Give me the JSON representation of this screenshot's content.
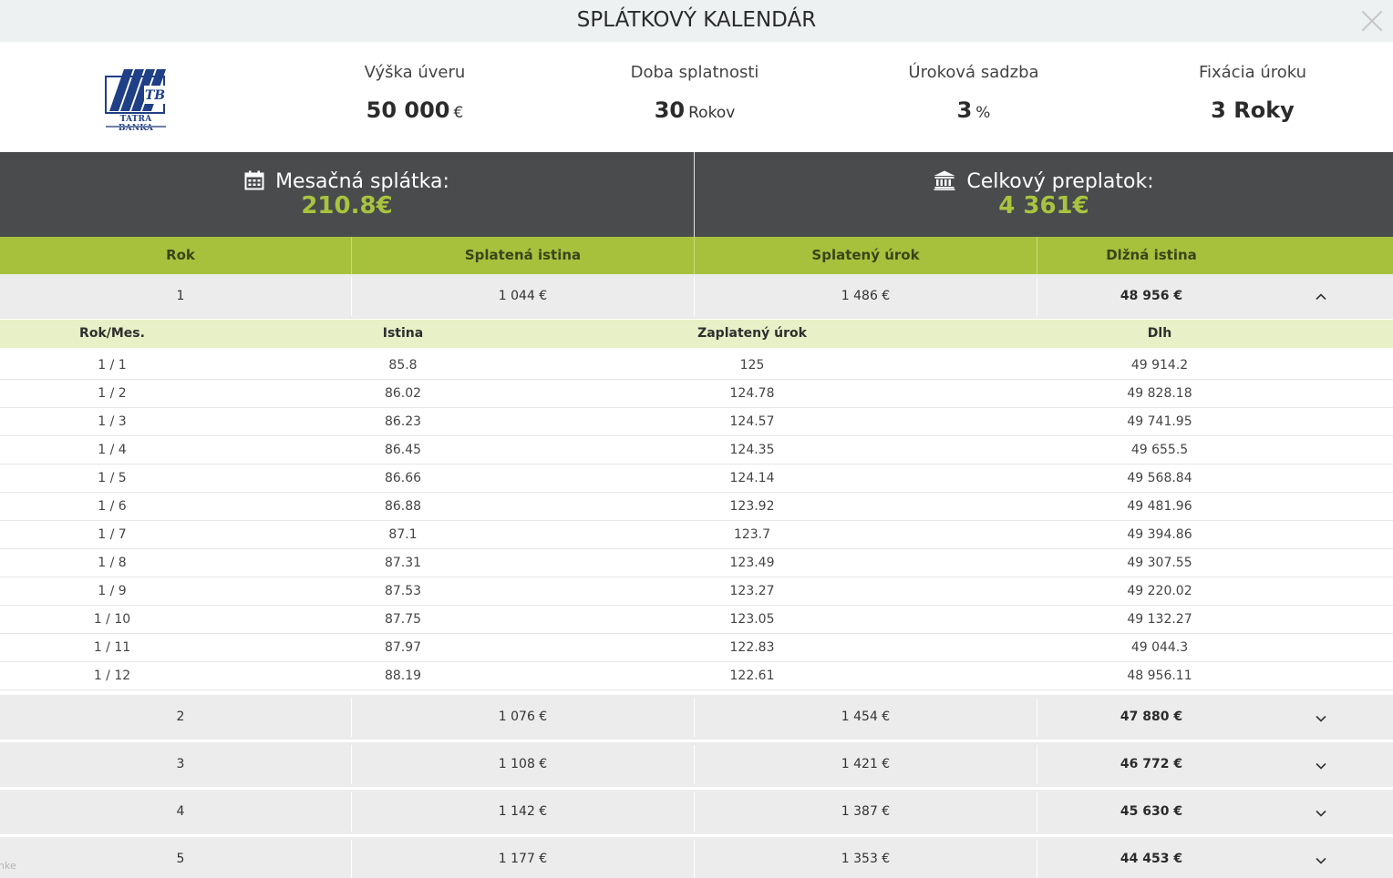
{
  "window": {
    "title": "SPLÁTKOVÝ KALENDÁR"
  },
  "bank": {
    "logo_mark": "TB",
    "logo_name": "TATRA BANKA"
  },
  "summary": {
    "loan_amount": {
      "label": "Výška úveru",
      "value": "50 000",
      "unit": "€"
    },
    "term": {
      "label": "Doba splatnosti",
      "value": "30",
      "unit": "Rokov"
    },
    "interest_rate": {
      "label": "Úroková sadzba",
      "value": "3",
      "unit": "%"
    },
    "fixation": {
      "label": "Fixácia úroku",
      "value": "3 Roky",
      "unit": ""
    }
  },
  "highlights": {
    "monthly_payment": {
      "label": "Mesačná splátka:",
      "value": "210.8€",
      "icon": "calendar-icon"
    },
    "total_overpayment": {
      "label": "Celkový preplatok:",
      "value": "4 361€",
      "icon": "bank-icon"
    }
  },
  "table": {
    "headers": [
      "Rok",
      "Splatená istina",
      "Splatený úrok",
      "Dlžná istina"
    ],
    "years": [
      {
        "year": "1",
        "principal": "1 044 €",
        "interest": "1 486 €",
        "remaining": "48 956 €",
        "expanded": true
      },
      {
        "year": "2",
        "principal": "1 076 €",
        "interest": "1 454 €",
        "remaining": "47 880 €",
        "expanded": false
      },
      {
        "year": "3",
        "principal": "1 108 €",
        "interest": "1 421 €",
        "remaining": "46 772 €",
        "expanded": false
      },
      {
        "year": "4",
        "principal": "1 142 €",
        "interest": "1 387 €",
        "remaining": "45 630 €",
        "expanded": false
      },
      {
        "year": "5",
        "principal": "1 177 €",
        "interest": "1 353 €",
        "remaining": "44 453 €",
        "expanded": false
      }
    ],
    "monthly_headers": [
      "Rok/Mes.",
      "Istina",
      "Zaplatený úrok",
      "Dlh"
    ],
    "months": [
      {
        "period": "1 / 1",
        "principal": "85.8",
        "interest": "125",
        "debt": "49 914.2"
      },
      {
        "period": "1 / 2",
        "principal": "86.02",
        "interest": "124.78",
        "debt": "49 828.18"
      },
      {
        "period": "1 / 3",
        "principal": "86.23",
        "interest": "124.57",
        "debt": "49 741.95"
      },
      {
        "period": "1 / 4",
        "principal": "86.45",
        "interest": "124.35",
        "debt": "49 655.5"
      },
      {
        "period": "1 / 5",
        "principal": "86.66",
        "interest": "124.14",
        "debt": "49 568.84"
      },
      {
        "period": "1 / 6",
        "principal": "86.88",
        "interest": "123.92",
        "debt": "49 481.96"
      },
      {
        "period": "1 / 7",
        "principal": "87.1",
        "interest": "123.7",
        "debt": "49 394.86"
      },
      {
        "period": "1 / 8",
        "principal": "87.31",
        "interest": "123.49",
        "debt": "49 307.55"
      },
      {
        "period": "1 / 9",
        "principal": "87.53",
        "interest": "123.27",
        "debt": "49 220.02"
      },
      {
        "period": "1 / 10",
        "principal": "87.75",
        "interest": "123.05",
        "debt": "49 132.27"
      },
      {
        "period": "1 / 11",
        "principal": "87.97",
        "interest": "122.83",
        "debt": "49 044.3"
      },
      {
        "period": "1 / 12",
        "principal": "88.19",
        "interest": "122.61",
        "debt": "48 956.11"
      }
    ]
  },
  "footer": {
    "corner_text": "nke"
  },
  "colors": {
    "accent_green": "#a7c13d",
    "highlight_green": "#a8c43f",
    "dark_band": "#4a4b4c",
    "subheader_green": "#e7f0c6",
    "logo_blue": "#1f3f86"
  }
}
